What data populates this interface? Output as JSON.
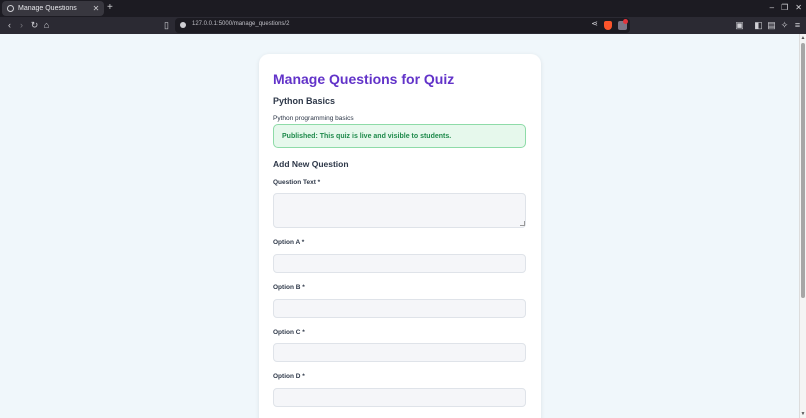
{
  "browser": {
    "tab_title": "Manage Questions",
    "url": "127.0.0.1:5000/manage_questions/2"
  },
  "page": {
    "title": "Manage Questions for Quiz",
    "quiz_name": "Python Basics",
    "quiz_description": "Python programming basics",
    "status_message": "Published: This quiz is live and visible to students.",
    "form_heading": "Add New Question",
    "fields": {
      "question_text": {
        "label": "Question Text *",
        "value": ""
      },
      "option_a": {
        "label": "Option A *",
        "value": ""
      },
      "option_b": {
        "label": "Option B *",
        "value": ""
      },
      "option_c": {
        "label": "Option C *",
        "value": ""
      },
      "option_d": {
        "label": "Option D *",
        "value": ""
      }
    }
  },
  "colors": {
    "title": "#6233c9",
    "status_bg": "#e6f8ec",
    "status_text": "#1e8a4b",
    "page_bg": "#f0f7fb"
  }
}
